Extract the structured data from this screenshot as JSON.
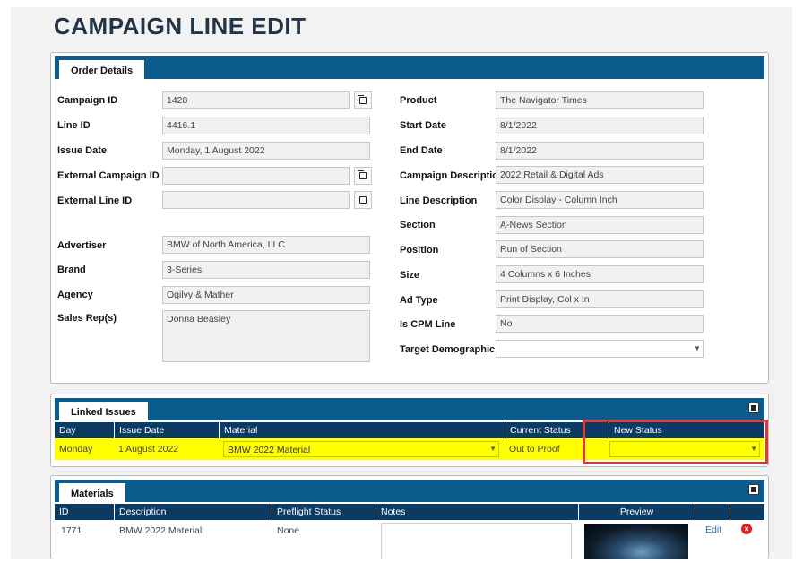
{
  "page": {
    "title": "CAMPAIGN LINE EDIT"
  },
  "order_details": {
    "tab": "Order Details",
    "left": [
      {
        "label": "Campaign ID",
        "value": "1428",
        "copy": true
      },
      {
        "label": "Line ID",
        "value": "4416.1",
        "copy": false
      },
      {
        "label": "Issue Date",
        "value": "Monday, 1 August 2022",
        "copy": false
      },
      {
        "label": "External Campaign ID",
        "value": "",
        "copy": true
      },
      {
        "label": "External Line ID",
        "value": "",
        "copy": true
      }
    ],
    "left2": [
      {
        "label": "Advertiser",
        "value": "BMW of North America, LLC"
      },
      {
        "label": "Brand",
        "value": "3-Series"
      },
      {
        "label": "Agency",
        "value": "Ogilvy & Mather"
      },
      {
        "label": "Sales Rep(s)",
        "value": "Donna Beasley"
      }
    ],
    "right": [
      {
        "label": "Product",
        "value": "The Navigator Times"
      },
      {
        "label": "Start Date",
        "value": "8/1/2022"
      },
      {
        "label": "End Date",
        "value": "8/1/2022"
      },
      {
        "label": "Campaign Description",
        "value": "2022 Retail & Digital Ads"
      },
      {
        "label": "Line Description",
        "value": "Color Display - Column Inch"
      },
      {
        "label": "Section",
        "value": "A-News Section"
      },
      {
        "label": "Position",
        "value": "Run of Section"
      },
      {
        "label": "Size",
        "value": "4 Columns x 6 Inches"
      },
      {
        "label": "Ad Type",
        "value": "Print Display, Col x In"
      },
      {
        "label": "Is CPM Line",
        "value": "No"
      },
      {
        "label": "Target Demographic",
        "value": ""
      }
    ]
  },
  "linked_issues": {
    "tab": "Linked Issues",
    "columns": [
      "Day",
      "Issue Date",
      "Material",
      "Current Status",
      "New Status"
    ],
    "row": {
      "day": "Monday",
      "issue_date": "1 August 2022",
      "material": "BMW 2022 Material",
      "current_status": "Out to Proof",
      "new_status": ""
    }
  },
  "materials": {
    "tab": "Materials",
    "columns": [
      "ID",
      "Description",
      "Preflight Status",
      "Notes",
      "Preview"
    ],
    "row": {
      "id": "1771",
      "description": "BMW 2022 Material",
      "preflight": "None",
      "notes": "",
      "edit": "Edit"
    }
  },
  "icons": {
    "copy": "copy-icon",
    "dropdown": "chevron-down-icon",
    "collapse": "collapse-icon",
    "delete": "delete-icon"
  },
  "colors": {
    "header_blue": "#0b5c8d",
    "grid_header": "#0b3a63",
    "highlight": "#ffff00",
    "callout_red": "#d93c3c",
    "delete_red": "#e02020",
    "link_blue": "#2a6fb5"
  }
}
